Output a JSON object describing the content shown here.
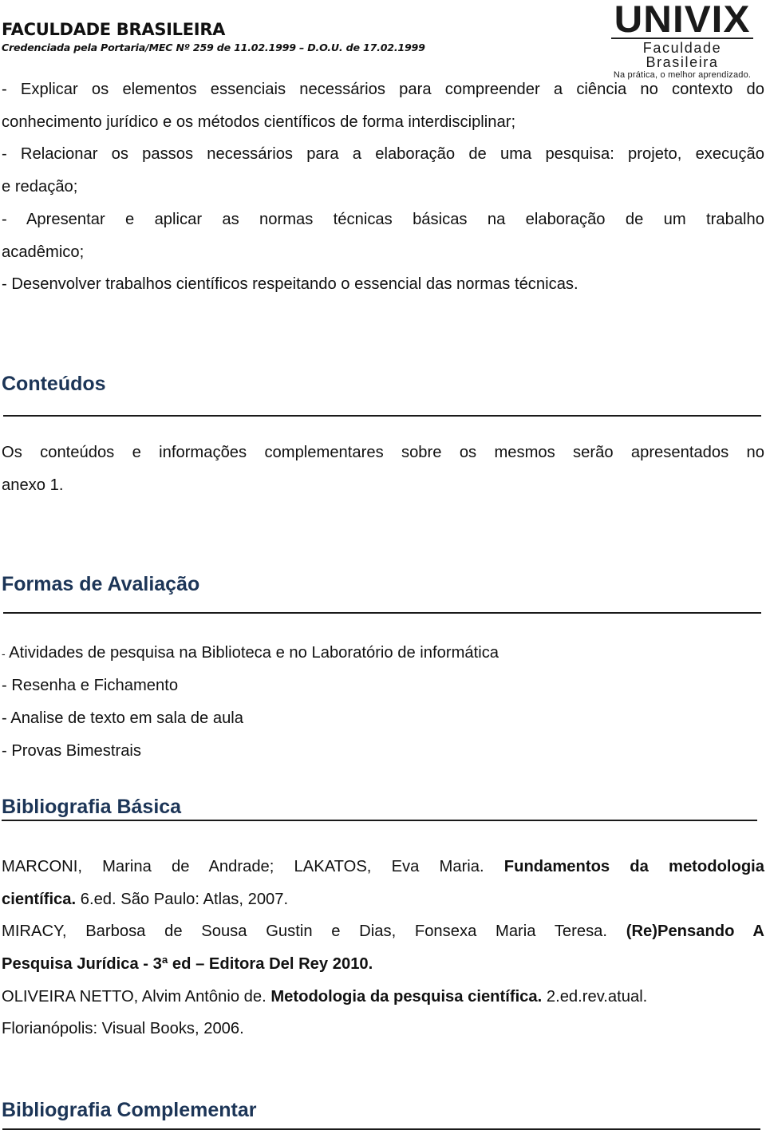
{
  "header": {
    "institution": "FACULDADE BRASILEIRA",
    "credential": "Credenciada pela Portaria/MEC Nº 259  de 11.02.1999 –  D.O.U. de 17.02.1999",
    "logo": {
      "name": "UNIVIX",
      "subtitle": "Faculdade Brasileira",
      "tagline": "Na prática, o melhor aprendizado."
    }
  },
  "objectives": [
    "- Explicar os elementos essenciais necessários para compreender a ciência no contexto do",
    "conhecimento jurídico e os métodos científicos de forma interdisciplinar;",
    "- Relacionar os passos necessários para a elaboração de uma pesquisa: projeto, execução",
    "e redação;",
    "- Apresentar e aplicar as normas técnicas básicas na elaboração de um trabalho",
    "acadêmico;",
    "- Desenvolver trabalhos científicos respeitando o essencial das normas técnicas."
  ],
  "conteudos": {
    "title": "Conteúdos",
    "text_line1": "Os conteúdos e informações complementares sobre os mesmos serão apresentados no",
    "text_line2": "anexo 1."
  },
  "avaliacao": {
    "title": "Formas de Avaliação",
    "items": [
      {
        "dash": "-",
        "text": " Atividades de pesquisa na Biblioteca e no Laboratório de informática"
      },
      {
        "dash": "-",
        "text": " Resenha e Fichamento"
      },
      {
        "dash": "-",
        "text": " Analise de texto em sala de aula"
      },
      {
        "dash": "-",
        "text": " Provas Bimestrais"
      }
    ]
  },
  "bibliografia_basica": {
    "title": "Bibliografia Básica",
    "entries": [
      {
        "line1_plain": "MARCONI, Marina de Andrade; LAKATOS, Eva Maria. ",
        "line1_bold": "Fundamentos da metodologia",
        "line2_bold": "científica.",
        "line2_plain": " 6.ed. São Paulo: Atlas, 2007."
      },
      {
        "line1_plain": "MIRACY,  Barbosa de Sousa Gustin e Dias, Fonsexa Maria Teresa. ",
        "line1_bold": "(Re)Pensando A",
        "line2_bold": "Pesquisa Jurídica - 3ª ed – Editora Del Rey 2010.",
        "line2_plain": ""
      },
      {
        "line1_plain": "OLIVEIRA NETTO, Alvim Antônio de. ",
        "line1_bold": "Metodologia da pesquisa científica.",
        "line1_tail": " 2.ed.rev.atual.",
        "line2_plain": "Florianópolis: Visual Books, 2006."
      }
    ]
  },
  "bibliografia_complementar": {
    "title": "Bibliografia Complementar"
  }
}
